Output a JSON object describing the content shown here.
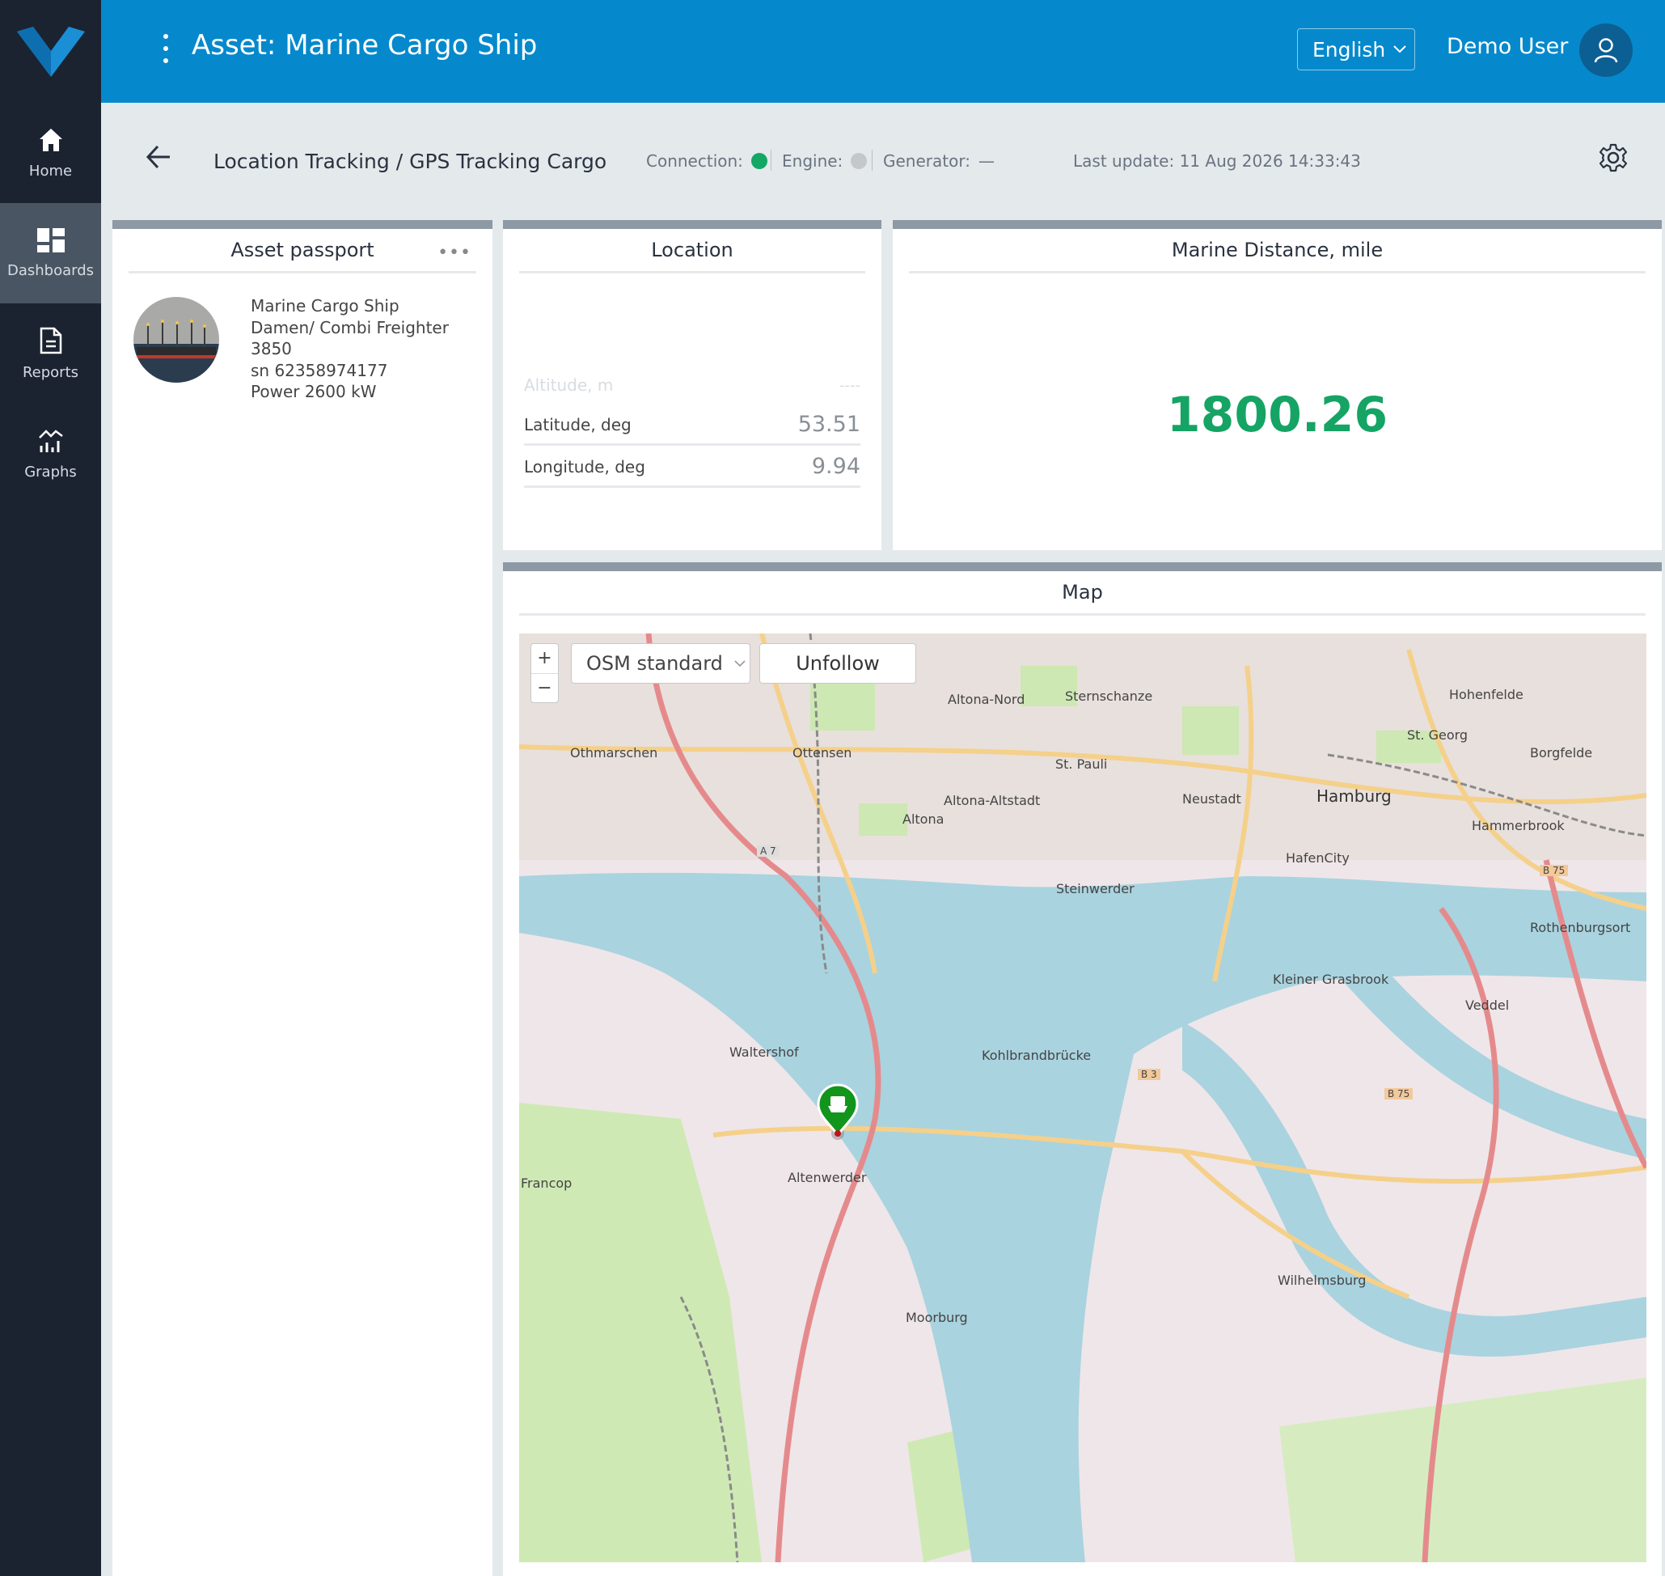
{
  "app": {
    "title": "Asset: Marine Cargo Ship",
    "language": "English",
    "user_name": "Demo User"
  },
  "sidebar": {
    "items": [
      {
        "label": "Home",
        "icon": "home-icon"
      },
      {
        "label": "Dashboards",
        "icon": "dashboard-icon",
        "active": true
      },
      {
        "label": "Reports",
        "icon": "report-icon"
      },
      {
        "label": "Graphs",
        "icon": "graph-icon"
      }
    ]
  },
  "subheader": {
    "breadcrumb": "Location Tracking / GPS Tracking Cargo",
    "connection_label": "Connection:",
    "engine_label": "Engine:",
    "generator_label": "Generator:",
    "generator_value": "—",
    "last_update": "Last update: 11 Aug 2026 14:33:43",
    "colors": {
      "connection": "#12a765",
      "engine": "#c4c8cc"
    }
  },
  "passport": {
    "title": "Asset passport",
    "more": "•••",
    "lines": [
      "Marine Cargo Ship",
      "Damen/ Combi Freighter 3850",
      "sn 62358974177",
      "Power 2600 kW"
    ]
  },
  "location": {
    "title": "Location",
    "rows": [
      {
        "label": "Altitude, m",
        "value": "----"
      },
      {
        "label": "Latitude, deg",
        "value": "53.51"
      },
      {
        "label": "Longitude, deg",
        "value": "9.94"
      }
    ]
  },
  "distance": {
    "title": "Marine Distance, mile",
    "value": "1800.26"
  },
  "map": {
    "title": "Map",
    "zoom_in": "+",
    "zoom_out": "−",
    "layer": "OSM standard",
    "follow_button": "Unfollow",
    "labels": {
      "altona_nord": "Altona-Nord",
      "sternschanze": "Sternschanze",
      "hohenfelde": "Hohenfelde",
      "othmarschen": "Othmarschen",
      "ottensen": "Ottensen",
      "st_pauli": "St. Pauli",
      "st_georg": "St. Georg",
      "borgfelde": "Borgfelde",
      "altona_altstadt": "Altona-Altstadt",
      "neustadt": "Neustadt",
      "hamburg": "Hamburg",
      "altona": "Altona",
      "hammerbrook": "Hammerbrook",
      "hafencity": "HafenCity",
      "steinwerder": "Steinwerder",
      "rothenburgsort": "Rothenburgsort",
      "kleiner_grasbrook": "Kleiner Grasbrook",
      "veddel": "Veddel",
      "waltershof": "Waltershof",
      "kohlbrandbrucke": "Kohlbrandbrücke",
      "altenwerder": "Altenwerder",
      "francop": "Francop",
      "wilhelmsburg": "Wilhelmsburg",
      "moorburg": "Moorburg",
      "a7": "A 7",
      "b75": "B 75",
      "b3": "B 3"
    }
  }
}
